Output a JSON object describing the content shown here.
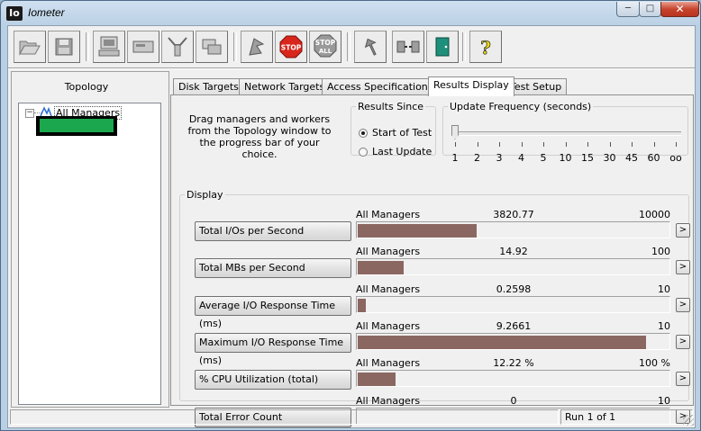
{
  "window": {
    "app_icon_text": "Io",
    "title": "Iometer",
    "minimize_glyph": "─",
    "maximize_glyph": "□",
    "close_glyph": "✕"
  },
  "toolbar": {
    "buttons": [
      {
        "icon": "open-folder-icon"
      },
      {
        "icon": "save-disk-icon"
      },
      {
        "icon": "new-manager-icon"
      },
      {
        "icon": "new-disk-worker-icon"
      },
      {
        "icon": "new-network-worker-icon"
      },
      {
        "icon": "duplicate-worker-icon"
      },
      {
        "icon": "start-flag-icon"
      },
      {
        "icon": "stop-icon",
        "label": "STOP"
      },
      {
        "icon": "stop-all-icon",
        "label": "STOP",
        "sublabel": "ALL"
      },
      {
        "icon": "reset-arrow-icon"
      },
      {
        "icon": "disconnect-icon"
      },
      {
        "icon": "exit-door-icon"
      },
      {
        "icon": "about-help-icon",
        "label": "?"
      }
    ]
  },
  "topology": {
    "header": "Topology",
    "tree_toggle": "−",
    "root_label": "All Managers"
  },
  "tabs": [
    {
      "label": "Disk Targets",
      "active": false
    },
    {
      "label": "Network Targets",
      "active": false
    },
    {
      "label": "Access Specifications",
      "active": false
    },
    {
      "label": "Results Display",
      "active": true
    },
    {
      "label": "Test Setup",
      "active": false
    }
  ],
  "results": {
    "drag_text": "Drag managers and workers from the Topology window to the progress bar of your choice.",
    "results_since": {
      "legend": "Results Since",
      "options": [
        "Start of Test",
        "Last Update"
      ],
      "selected": 0
    },
    "update_frequency": {
      "legend": "Update Frequency (seconds)",
      "ticks": [
        "1",
        "2",
        "3",
        "4",
        "5",
        "10",
        "15",
        "30",
        "45",
        "60",
        "oo"
      ],
      "selected_index": 0
    },
    "display_legend": "Display",
    "go_glyph": ">",
    "metrics": [
      {
        "label": "Total I/Os per Second",
        "manager": "All Managers",
        "value": "3820.77",
        "max": "10000",
        "fraction": 0.382
      },
      {
        "label": "Total MBs per Second",
        "manager": "All Managers",
        "value": "14.92",
        "max": "100",
        "fraction": 0.149
      },
      {
        "label": "Average I/O Response Time (ms)",
        "manager": "All Managers",
        "value": "0.2598",
        "max": "10",
        "fraction": 0.026
      },
      {
        "label": "Maximum I/O Response Time (ms)",
        "manager": "All Managers",
        "value": "9.2661",
        "max": "10",
        "fraction": 0.927
      },
      {
        "label": "% CPU Utilization (total)",
        "manager": "All Managers",
        "value": "12.22 %",
        "max": "100 %",
        "fraction": 0.122
      },
      {
        "label": "Total Error Count",
        "manager": "All Managers",
        "value": "0",
        "max": "10",
        "fraction": 0
      }
    ]
  },
  "status": {
    "run_text": "Run 1 of 1"
  },
  "colors": {
    "bar_fill": "#8b6762",
    "worker_highlight": "#1aa74e"
  }
}
